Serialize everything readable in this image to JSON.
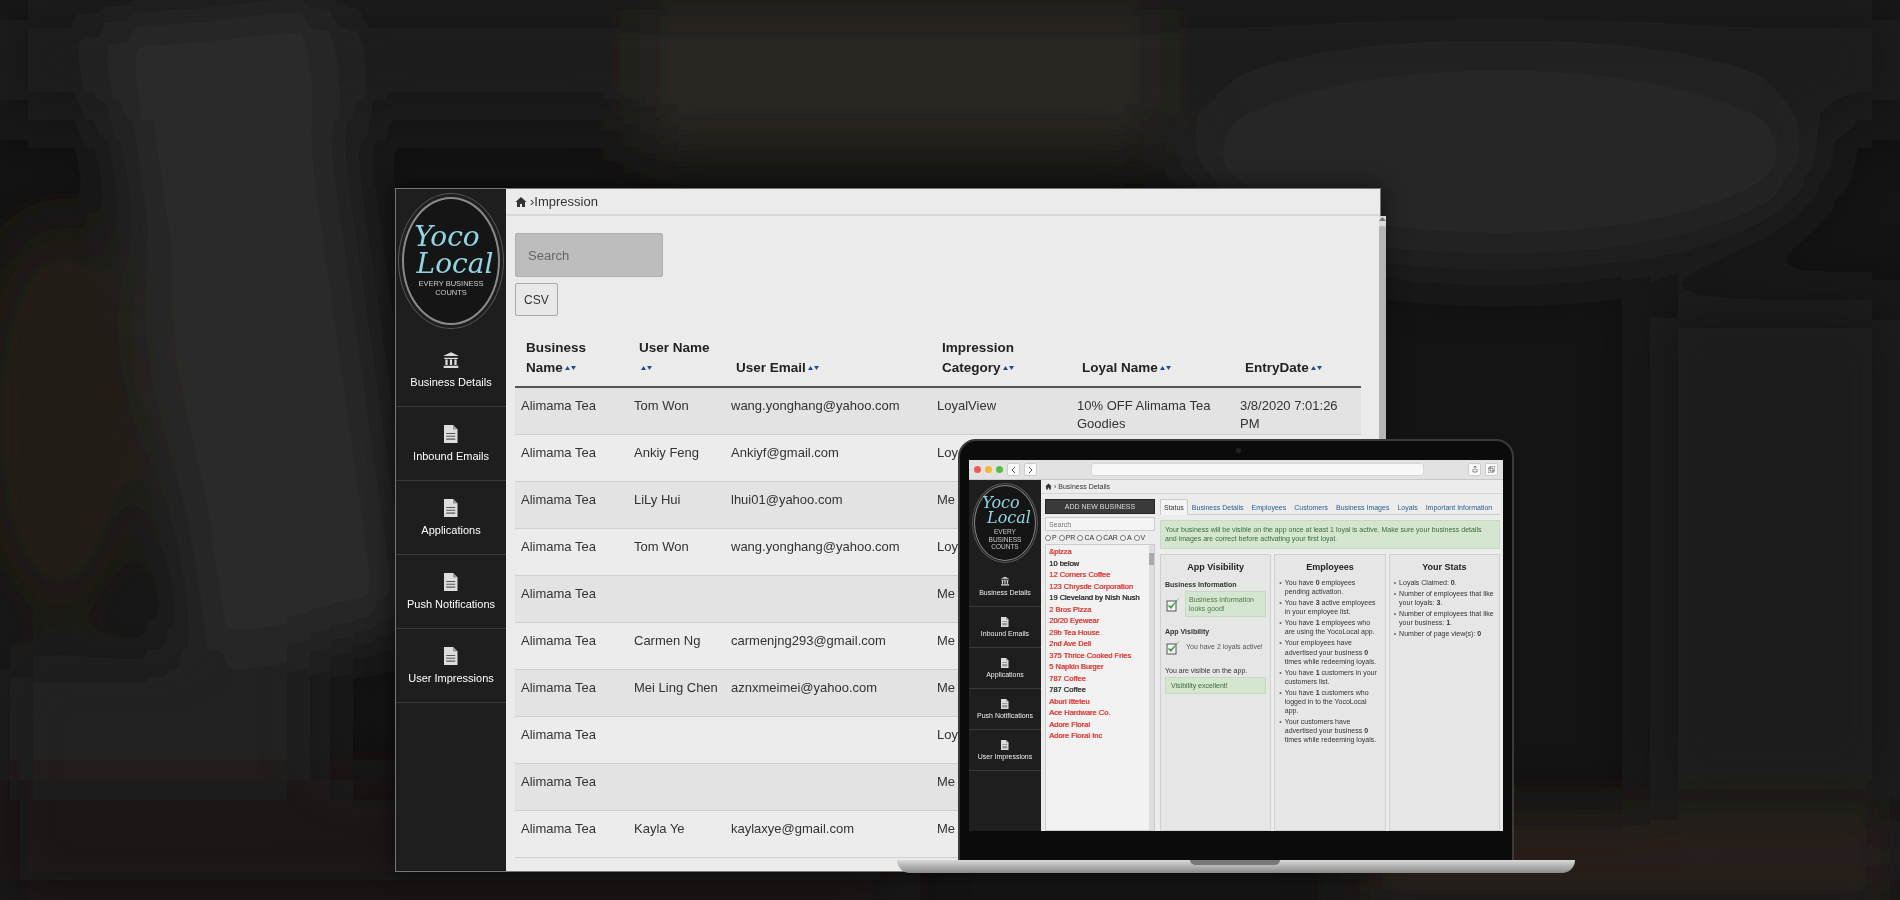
{
  "main_window": {
    "breadcrumb": {
      "separator": "›",
      "label": "Impression"
    },
    "logo": {
      "line1": "Yoco",
      "line2": "Local",
      "tagline": "EVERY BUSINESS COUNTS"
    },
    "sidebar": [
      {
        "label": "Business Details",
        "kind": "bank"
      },
      {
        "label": "Inbound Emails",
        "kind": "file"
      },
      {
        "label": "Applications",
        "kind": "file"
      },
      {
        "label": "Push Notifications",
        "kind": "file"
      },
      {
        "label": "User Impressions",
        "kind": "file"
      }
    ],
    "search": {
      "placeholder": "Search"
    },
    "csv_button": "CSV",
    "table": {
      "columns": [
        "Business Name",
        "User Name",
        "User Email",
        "Impression Category",
        "Loyal Name",
        "EntryDate"
      ],
      "rows": [
        {
          "business": "Alimama Tea",
          "user": "Tom Won",
          "email": "wang.yonghang@yahoo.com",
          "category": "LoyalView",
          "loyal_name": "10% OFF Alimama Tea Goodies",
          "entry_date": "3/8/2020 7:01:26 PM"
        },
        {
          "business": "Alimama Tea",
          "user": "Ankiy Feng",
          "email": "Ankiyf@gmail.com",
          "category": "Loy"
        },
        {
          "business": "Alimama Tea",
          "user": "LiLy Hui",
          "email": "lhui01@yahoo.com",
          "category": "Me"
        },
        {
          "business": "Alimama Tea",
          "user": "Tom Won",
          "email": "wang.yonghang@yahoo.com",
          "category": "Loy"
        },
        {
          "business": "Alimama Tea",
          "category": "Me"
        },
        {
          "business": "Alimama Tea",
          "user": "Carmen Ng",
          "email": "carmenjng293@gmail.com",
          "category": "Me"
        },
        {
          "business": "Alimama Tea",
          "user": "Mei Ling Chen",
          "email": "aznxmeimei@yahoo.com",
          "category": "Me"
        },
        {
          "business": "Alimama Tea",
          "category": "Loy"
        },
        {
          "business": "Alimama Tea",
          "category": "Me"
        },
        {
          "business": "Alimama Tea",
          "user": "Kayla Ye",
          "email": "kaylaxye@gmail.com",
          "category": "Me"
        }
      ]
    }
  },
  "laptop": {
    "breadcrumb": {
      "separator": "›",
      "label": "Business Details"
    },
    "logo": {
      "line1": "Yoco",
      "line2": "Local",
      "tagline": "EVERY BUSINESS COUNTS"
    },
    "sidebar": [
      {
        "label": "Business Details",
        "kind": "bank"
      },
      {
        "label": "Inbound Emails",
        "kind": "file"
      },
      {
        "label": "Applications",
        "kind": "file"
      },
      {
        "label": "Push Notifications",
        "kind": "file"
      },
      {
        "label": "User Impressions",
        "kind": "file"
      }
    ],
    "add_button": "ADD NEW BUSINESS",
    "search": {
      "placeholder": "Search"
    },
    "filters": [
      {
        "label": "P",
        "selected": false
      },
      {
        "label": "PR",
        "selected": false
      },
      {
        "label": "CA",
        "selected": false
      },
      {
        "label": "CAR",
        "selected": false
      },
      {
        "label": "A",
        "selected": false
      },
      {
        "label": "V",
        "selected": false
      }
    ],
    "businesses": [
      {
        "name": "&pizza",
        "color": "#e0403a"
      },
      {
        "name": "10 below",
        "color": "#333333"
      },
      {
        "name": "12 Corners Coffee",
        "color": "#e0403a"
      },
      {
        "name": "123 Chrysde Corporation",
        "color": "#e0403a"
      },
      {
        "name": "19 Cleveland by Nish Nush",
        "color": "#333333"
      },
      {
        "name": "2 Bros Pizza",
        "color": "#e0403a"
      },
      {
        "name": "20/20 Eyewear",
        "color": "#e0403a"
      },
      {
        "name": "29b Tea House",
        "color": "#e0403a"
      },
      {
        "name": "2nd Ave Deli",
        "color": "#e0403a"
      },
      {
        "name": "375 Thrice Cooked Fries",
        "color": "#e0403a"
      },
      {
        "name": "5 Napkin Burger",
        "color": "#e0403a"
      },
      {
        "name": "787 Coffee",
        "color": "#e0403a"
      },
      {
        "name": "787 Coffee",
        "color": "#333333"
      },
      {
        "name": "Aburi Itteteu",
        "color": "#e0403a"
      },
      {
        "name": "Ace Hardware Co.",
        "color": "#e0403a"
      },
      {
        "name": "Adore Floral",
        "color": "#e0403a"
      },
      {
        "name": "Adore Floral Inc",
        "color": "#e0403a"
      }
    ],
    "tabs": [
      {
        "label": "Status",
        "selected": true
      },
      {
        "label": "Business Details",
        "selected": false
      },
      {
        "label": "Employees",
        "selected": false
      },
      {
        "label": "Customers",
        "selected": false
      },
      {
        "label": "Business Images",
        "selected": false
      },
      {
        "label": "Loyals",
        "selected": false
      },
      {
        "label": "Important Information",
        "selected": false
      }
    ],
    "alert": "Your business will be visible on the app once at least 1 loyal is active. Make sure your business details and images are correct before activating your first loyal.",
    "cards": [
      {
        "kind": "visibility",
        "title": "App Visibility",
        "sections": [
          {
            "heading": "Business Information",
            "checked": true,
            "note": "Business information looks good!",
            "boxed": true
          },
          {
            "heading": "App Visibility",
            "checked": true,
            "note": "You have 2 loyals active!",
            "boxed": false
          }
        ],
        "status": "You are visible on the app.",
        "status_badge": "Visibility excellent!"
      },
      {
        "kind": "list",
        "title": "Employees",
        "bullet": "•",
        "items": [
          "You have **0** employees pending activation.",
          "You have **3** active employees in your employee list.",
          "You have **1** employees who are using the YocoLocal app.",
          "Your employees have advertised your business **0** times while redeeming loyals.",
          "You have **1** customers in your customers list.",
          "You have **1** customers who logged in to the YocoLocal app.",
          "Your customers have advertised your business **0** times while redeeming loyals."
        ]
      },
      {
        "kind": "list",
        "title": "Your Stats",
        "bullet": "•",
        "items": [
          "Loyals Claimed: **0**.",
          "Number of employees that like your loyals: **3**.",
          "Number of employees that like your business: **1**.",
          "Number of page view(s): **0**"
        ]
      }
    ]
  }
}
